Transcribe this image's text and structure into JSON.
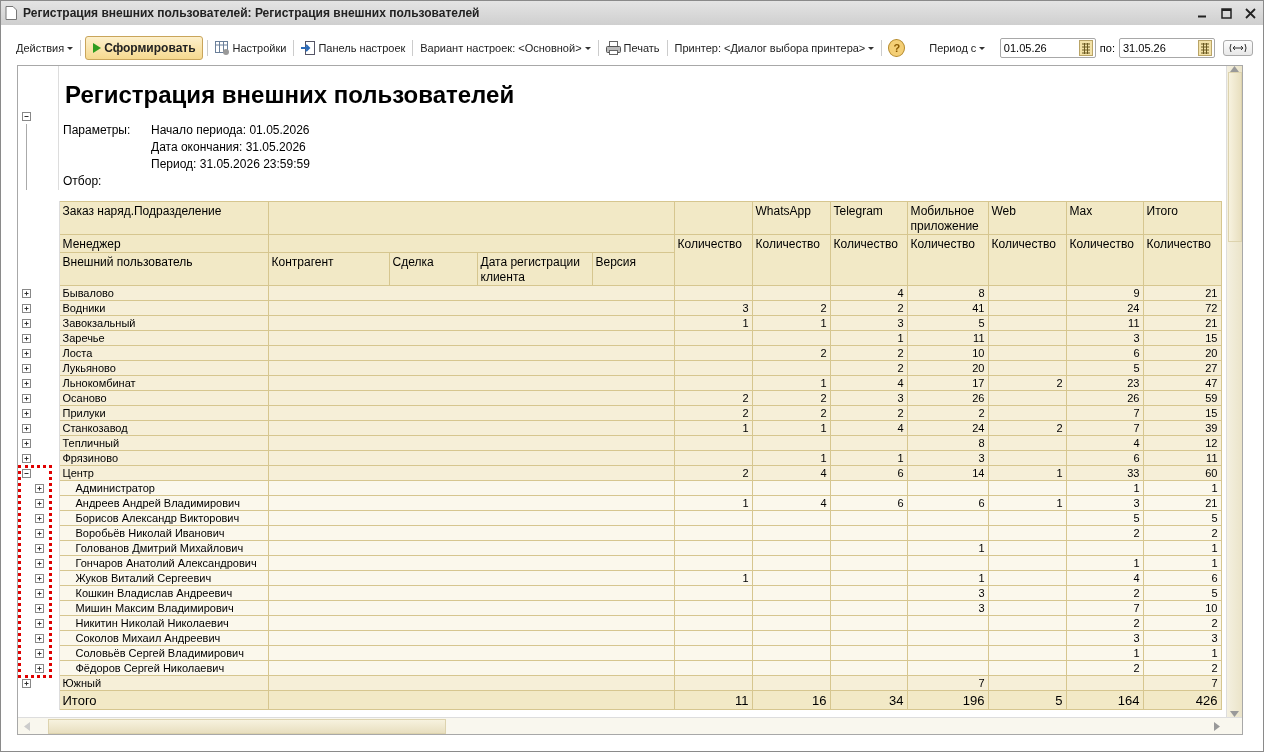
{
  "window": {
    "title": "Регистрация внешних пользователей: Регистрация внешних пользователей"
  },
  "toolbar": [
    {
      "kind": "dropdown",
      "label": "Действия"
    },
    {
      "kind": "run",
      "label": "Сформировать"
    },
    {
      "kind": "settings",
      "label": "Настройки"
    },
    {
      "kind": "panel",
      "label": "Панель настроек"
    },
    {
      "kind": "dropdown",
      "label": "Вариант настроек: <Основной>"
    },
    {
      "kind": "print",
      "label": "Печать"
    },
    {
      "kind": "dropdown",
      "label": "Принтер: <Диалог выбора принтера>"
    },
    {
      "kind": "help",
      "label": "?"
    }
  ],
  "period": {
    "label": "Период с",
    "from": "01.05.26",
    "to_label": "по:",
    "to": "31.05.26"
  },
  "report": {
    "title": "Регистрация внешних пользователей",
    "header_expanded": true,
    "params_label": "Параметры:",
    "params": [
      "Начало периода: 01.05.2026",
      "Дата окончания: 31.05.2026",
      "Период: 31.05.2026 23:59:59"
    ],
    "filter_label": "Отбор:",
    "grouping_headers": [
      "Заказ наряд.Подразделение",
      "Менеджер",
      "Внешний пользователь"
    ],
    "detail_columns": [
      "Контрагент",
      "Сделка",
      "Дата регистрации клиента",
      "Версия"
    ],
    "channels": [
      {
        "measure": "Количество"
      },
      {
        "name": "WhatsApp",
        "measure": "Количество"
      },
      {
        "name": "Telegram",
        "measure": "Количество"
      },
      {
        "name": "Мобильное приложение",
        "measure": "Количество"
      },
      {
        "name": "Web",
        "measure": "Количество"
      },
      {
        "name": "Max",
        "measure": "Количество"
      },
      {
        "name": "Итого",
        "measure": "Количество"
      }
    ],
    "rows": [
      {
        "name": "Бывалово",
        "expanded": false,
        "values": {
          "telegram": "4",
          "mobile_app": "8",
          "max": "9",
          "total": "21"
        }
      },
      {
        "name": "Водники",
        "expanded": false,
        "values": {
          "column_1": "3",
          "whatsapp": "2",
          "telegram": "2",
          "mobile_app": "41",
          "max": "24",
          "total": "72"
        }
      },
      {
        "name": "Завокзальный",
        "expanded": false,
        "values": {
          "column_1": "1",
          "whatsapp": "1",
          "telegram": "3",
          "mobile_app": "5",
          "max": "11",
          "total": "21"
        }
      },
      {
        "name": "Заречье",
        "expanded": false,
        "values": {
          "telegram": "1",
          "mobile_app": "11",
          "max": "3",
          "total": "15"
        }
      },
      {
        "name": "Лоста",
        "expanded": false,
        "values": {
          "whatsapp": "2",
          "telegram": "2",
          "mobile_app": "10",
          "max": "6",
          "total": "20"
        }
      },
      {
        "name": "Лукьяново",
        "expanded": false,
        "values": {
          "telegram": "2",
          "mobile_app": "20",
          "max": "5",
          "total": "27"
        }
      },
      {
        "name": "Льнокомбинат",
        "expanded": false,
        "values": {
          "whatsapp": "1",
          "telegram": "4",
          "mobile_app": "17",
          "web": "2",
          "max": "23",
          "total": "47"
        }
      },
      {
        "name": "Осаново",
        "expanded": false,
        "values": {
          "column_1": "2",
          "whatsapp": "2",
          "telegram": "3",
          "mobile_app": "26",
          "max": "26",
          "total": "59"
        }
      },
      {
        "name": "Прилуки",
        "expanded": false,
        "values": {
          "column_1": "2",
          "whatsapp": "2",
          "telegram": "2",
          "mobile_app": "2",
          "max": "7",
          "total": "15"
        }
      },
      {
        "name": "Станкозавод",
        "expanded": false,
        "values": {
          "column_1": "1",
          "whatsapp": "1",
          "telegram": "4",
          "mobile_app": "24",
          "web": "2",
          "max": "7",
          "total": "39"
        }
      },
      {
        "name": "Тепличный",
        "expanded": false,
        "values": {
          "mobile_app": "8",
          "max": "4",
          "total": "12"
        }
      },
      {
        "name": "Фрязиново",
        "expanded": false,
        "values": {
          "whatsapp": "1",
          "telegram": "1",
          "mobile_app": "3",
          "max": "6",
          "total": "11"
        }
      },
      {
        "name": "Центр",
        "expanded": true,
        "highlight": true,
        "values": {
          "column_1": "2",
          "whatsapp": "4",
          "telegram": "6",
          "mobile_app": "14",
          "web": "1",
          "max": "33",
          "total": "60"
        },
        "children": [
          {
            "name": "Администратор",
            "expanded": false,
            "values": {
              "max": "1",
              "total": "1"
            }
          },
          {
            "name": "Андреев Андрей Владимирович",
            "expanded": false,
            "values": {
              "column_1": "1",
              "whatsapp": "4",
              "telegram": "6",
              "mobile_app": "6",
              "web": "1",
              "max": "3",
              "total": "21"
            }
          },
          {
            "name": "Борисов Александр Викторович",
            "expanded": false,
            "values": {
              "max": "5",
              "total": "5"
            }
          },
          {
            "name": "Воробьёв Николай Иванович",
            "expanded": false,
            "values": {
              "max": "2",
              "total": "2"
            }
          },
          {
            "name": "Голованов Дмитрий Михайлович",
            "expanded": false,
            "values": {
              "mobile_app": "1",
              "total": "1"
            }
          },
          {
            "name": "Гончаров Анатолий Александрович",
            "expanded": false,
            "values": {
              "max": "1",
              "total": "1"
            }
          },
          {
            "name": "Жуков Виталий Сергеевич",
            "expanded": false,
            "values": {
              "column_1": "1",
              "mobile_app": "1",
              "max": "4",
              "total": "6"
            }
          },
          {
            "name": "Кошкин Владислав Андреевич",
            "expanded": false,
            "values": {
              "mobile_app": "3",
              "max": "2",
              "total": "5"
            }
          },
          {
            "name": "Мишин Максим Владимирович",
            "expanded": false,
            "values": {
              "mobile_app": "3",
              "max": "7",
              "total": "10"
            }
          },
          {
            "name": "Никитин Николай Николаевич",
            "expanded": false,
            "values": {
              "max": "2",
              "total": "2"
            }
          },
          {
            "name": "Соколов Михаил Андреевич",
            "expanded": false,
            "values": {
              "max": "3",
              "total": "3"
            }
          },
          {
            "name": "Соловьёв Сергей Владимирович",
            "expanded": false,
            "values": {
              "max": "1",
              "total": "1"
            }
          },
          {
            "name": "Фёдоров Сергей Николаевич",
            "expanded": false,
            "values": {
              "max": "2",
              "total": "2"
            }
          }
        ]
      },
      {
        "name": "Южный",
        "expanded": false,
        "values": {
          "mobile_app": "7",
          "total": "7"
        }
      }
    ],
    "total": {
      "label": "Итого",
      "values": {
        "column_1": "11",
        "whatsapp": "16",
        "telegram": "34",
        "mobile_app": "196",
        "web": "5",
        "max": "164",
        "total": "426"
      }
    }
  }
}
